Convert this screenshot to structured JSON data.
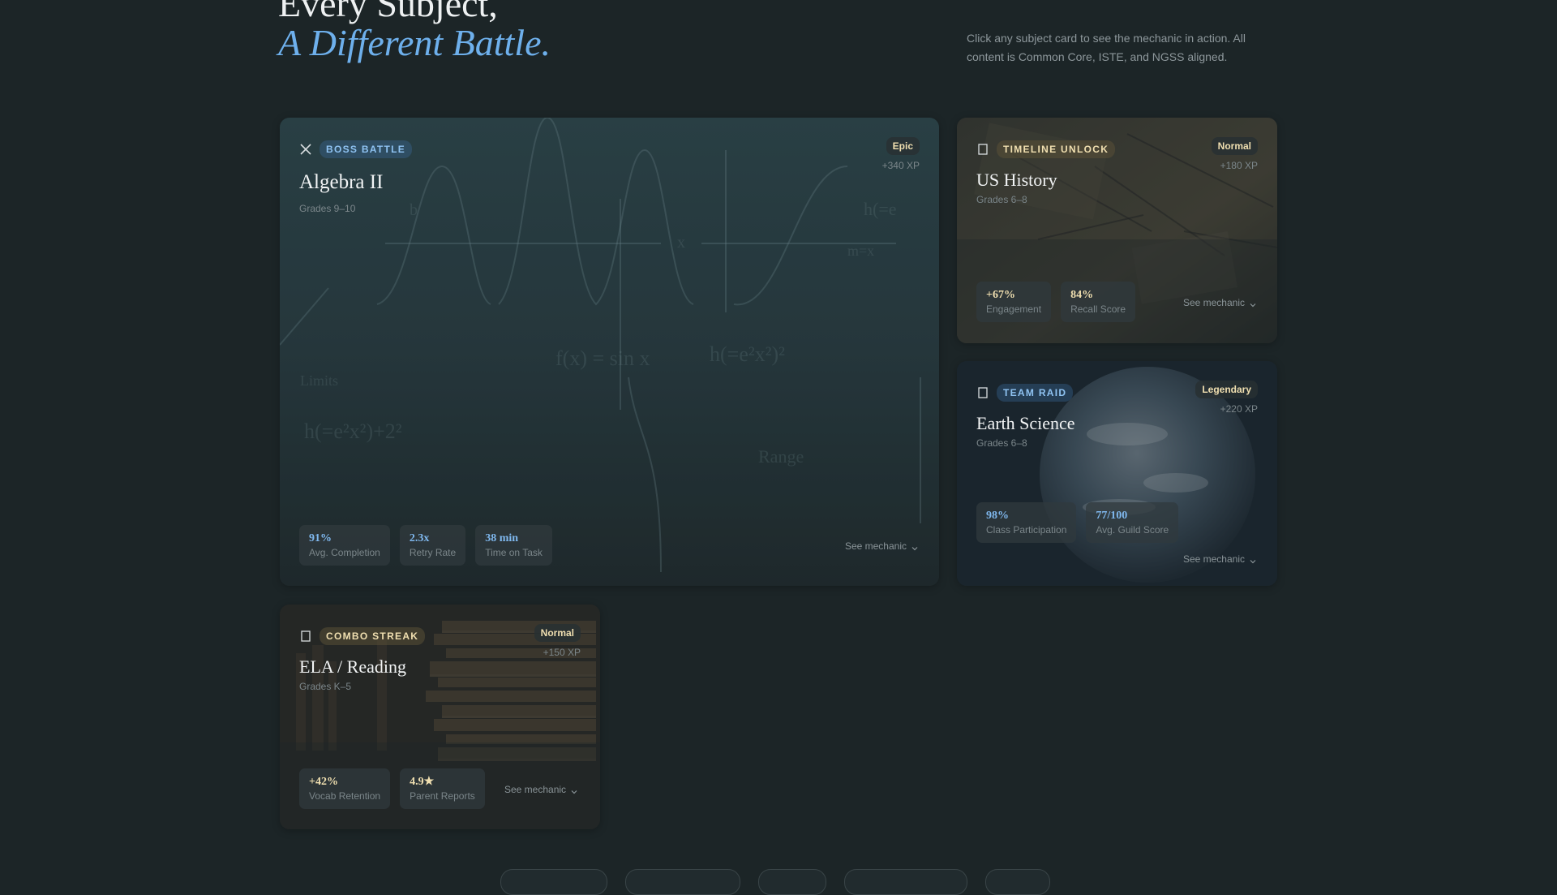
{
  "heading": {
    "line1": "Every Subject,",
    "line2": "A Different Battle."
  },
  "intro": "Click any subject card to see the mechanic in action. All content is Common Core, ISTE, and NGSS aligned.",
  "colors": {
    "background": "#1c2527",
    "accent_blue": "#6eb0ec",
    "accent_gold": "#f0dfb0"
  },
  "cards": [
    {
      "tag": "BOSS BATTLE",
      "tag_icon": "crossed-swords-icon",
      "title": "Algebra II",
      "grades": "Grades 9–10",
      "difficulty": "Epic",
      "xp": "+340 XP",
      "background": "chalkboard-math",
      "stats": [
        {
          "value": "91%",
          "label": "Avg. Completion"
        },
        {
          "value": "2.3x",
          "label": "Retry Rate"
        },
        {
          "value": "38 min",
          "label": "Time on Task"
        }
      ],
      "see_mechanic": "See mechanic"
    },
    {
      "tag": "TIMELINE UNLOCK",
      "tag_icon": "scroll-icon",
      "title": "US History",
      "grades": "Grades 6–8",
      "difficulty": "Normal",
      "xp": "+180 XP",
      "background": "historic-documents",
      "stats": [
        {
          "value": "+67%",
          "label": "Engagement"
        },
        {
          "value": "84%",
          "label": "Recall Score"
        }
      ],
      "see_mechanic": "See mechanic"
    },
    {
      "tag": "TEAM RAID",
      "tag_icon": "globe-icon",
      "title": "Earth Science",
      "grades": "Grades 6–8",
      "difficulty": "Legendary",
      "xp": "+220 XP",
      "background": "planet-earth",
      "stats": [
        {
          "value": "98%",
          "label": "Class Participation"
        },
        {
          "value": "77/100",
          "label": "Avg. Guild Score"
        }
      ],
      "see_mechanic": "See mechanic"
    },
    {
      "tag": "COMBO STREAK",
      "tag_icon": "book-icon",
      "title": "ELA / Reading",
      "grades": "Grades K–5",
      "difficulty": "Normal",
      "xp": "+150 XP",
      "background": "stacked-books",
      "stats": [
        {
          "value": "+42%",
          "label": "Vocab Retention"
        },
        {
          "value": "4.9★",
          "label": "Parent Reports"
        }
      ],
      "see_mechanic": "See mechanic"
    }
  ]
}
